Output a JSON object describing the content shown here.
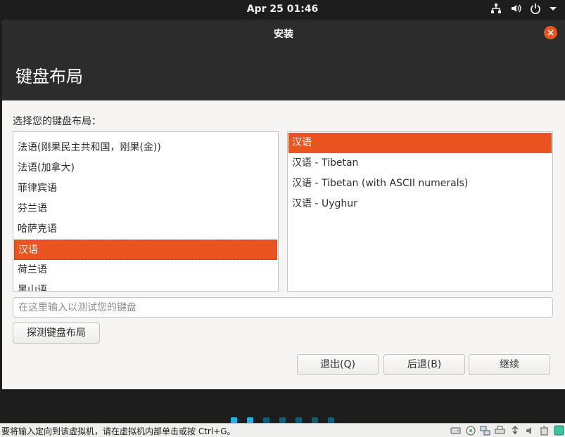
{
  "topbar": {
    "clock": "Apr 25  01:46",
    "icons": [
      "network-icon",
      "volume-icon",
      "power-icon",
      "chevron-down-icon"
    ]
  },
  "window": {
    "title": "安装",
    "page_title": "键盘布局",
    "prompt": "选择您的键盘布局：",
    "layouts": [
      {
        "label": "法语(刚果民主共和国，刚果(金))",
        "selected": false
      },
      {
        "label": "法语(加拿大)",
        "selected": false
      },
      {
        "label": "菲律宾语",
        "selected": false
      },
      {
        "label": "芬兰语",
        "selected": false
      },
      {
        "label": "哈萨克语",
        "selected": false
      },
      {
        "label": "汉语",
        "selected": true
      },
      {
        "label": "荷兰语",
        "selected": false
      },
      {
        "label": "黑山语",
        "selected": false
      }
    ],
    "variants": [
      {
        "label": "汉语",
        "selected": true
      },
      {
        "label": "汉语 - Tibetan",
        "selected": false
      },
      {
        "label": "汉语 - Tibetan (with ASCII numerals)",
        "selected": false
      },
      {
        "label": "汉语 - Uyghur",
        "selected": false
      }
    ],
    "test_placeholder": "在这里输入以测试您的键盘",
    "detect_button": "探测键盘布局",
    "quit_button": "退出(Q)",
    "back_button": "后退(B)",
    "continue_button": "继续"
  },
  "progress": {
    "total_steps": 7,
    "completed_steps": 2,
    "active_color": "#19b6ee",
    "inactive_color": "#0e5e7a"
  },
  "statusbar": {
    "message": "要将输入定向到该虚拟机，请在虚拟机内部单击或按 Ctrl+G。"
  },
  "colors": {
    "accent": "#e95420",
    "header_bg": "#2c2c2c"
  }
}
